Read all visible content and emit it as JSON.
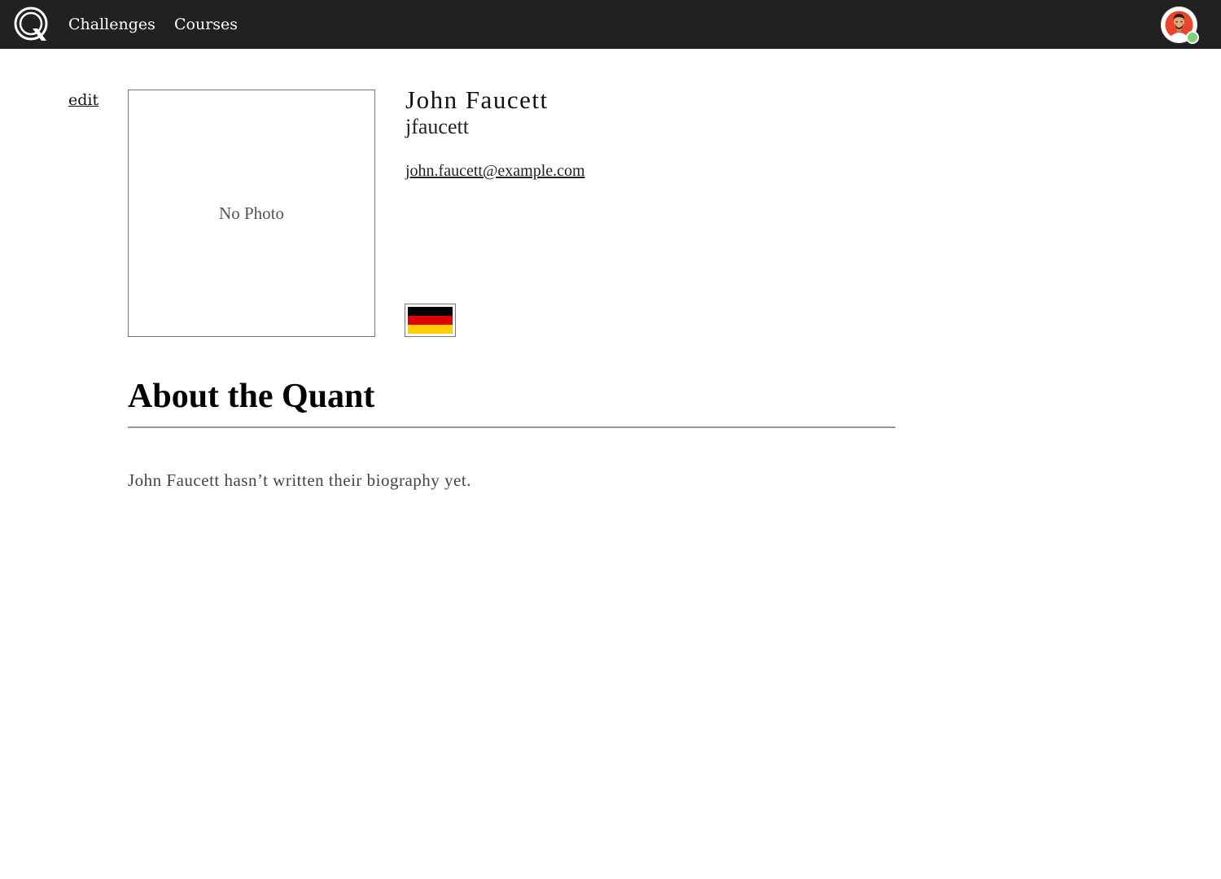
{
  "nav": {
    "logo_icon": "q-logo-icon",
    "links": [
      {
        "label": "Challenges"
      },
      {
        "label": "Courses"
      }
    ],
    "avatar_icon": "user-avatar-icon",
    "status_color": "#7ed07b"
  },
  "profile": {
    "edit_label": "edit",
    "photo_placeholder": "No Photo",
    "full_name": "John Faucett",
    "username": "jfaucett",
    "email": "john.faucett@example.com",
    "country_flag_icon": "germany-flag-icon",
    "flag_colors": [
      "#000000",
      "#dd0000",
      "#ffce00"
    ]
  },
  "about": {
    "heading": "About the Quant",
    "bio": "John Faucett hasn’t written their biography yet."
  }
}
